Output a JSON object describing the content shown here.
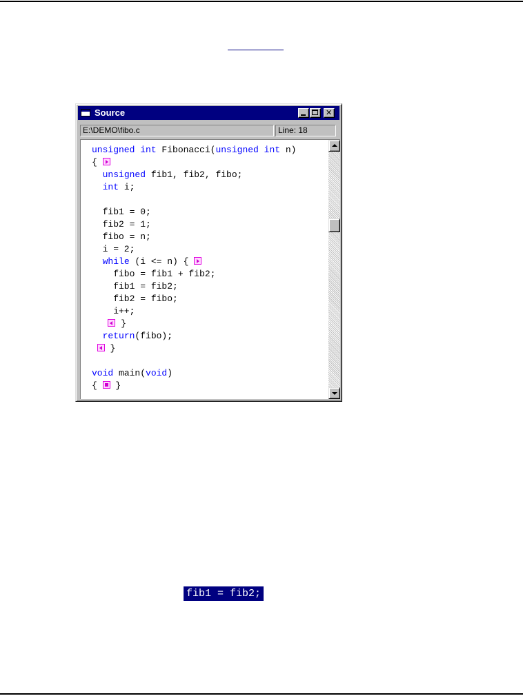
{
  "window": {
    "title": "Source",
    "file_path": "E:\\DEMO\\fibo.c",
    "line_status": "Line: 18"
  },
  "code": {
    "lines": [
      [
        {
          "t": "unsigned int",
          "c": "kw"
        },
        {
          "t": " Fibonacci("
        },
        {
          "t": "unsigned int",
          "c": "kw"
        },
        {
          "t": " n)"
        }
      ],
      [
        {
          "t": "{ "
        },
        {
          "fold": "right"
        }
      ],
      [
        {
          "t": "  "
        },
        {
          "t": "unsigned",
          "c": "kw"
        },
        {
          "t": " fib1, fib2, fibo;"
        }
      ],
      [
        {
          "t": "  "
        },
        {
          "t": "int",
          "c": "kw"
        },
        {
          "t": " i;"
        }
      ],
      [],
      [
        {
          "t": "  fib1 = 0;"
        }
      ],
      [
        {
          "t": "  fib2 = 1;"
        }
      ],
      [
        {
          "t": "  fibo = n;"
        }
      ],
      [
        {
          "t": "  i = 2;"
        }
      ],
      [
        {
          "t": "  "
        },
        {
          "t": "while",
          "c": "kw"
        },
        {
          "t": " (i <= n) { "
        },
        {
          "fold": "right"
        }
      ],
      [
        {
          "t": "    fibo = fib1 + fib2;"
        }
      ],
      [
        {
          "t": "    fib1 = fib2;"
        }
      ],
      [
        {
          "t": "    fib2 = fibo;"
        }
      ],
      [
        {
          "t": "    i++;"
        }
      ],
      [
        {
          "t": "   "
        },
        {
          "fold": "left"
        },
        {
          "t": " }"
        }
      ],
      [
        {
          "t": "  "
        },
        {
          "t": "return",
          "c": "kw"
        },
        {
          "t": "(fibo);"
        }
      ],
      [
        {
          "t": " "
        },
        {
          "fold": "left"
        },
        {
          "t": " }"
        }
      ],
      [],
      [
        {
          "t": "void",
          "c": "kw"
        },
        {
          "t": " main("
        },
        {
          "t": "void",
          "c": "kw"
        },
        {
          "t": ")"
        }
      ],
      [
        {
          "t": "{ "
        },
        {
          "fold": "square"
        },
        {
          "t": " }"
        }
      ]
    ]
  },
  "scrollbar": {
    "position": 0.3
  },
  "selection_snippet": "fib1 = fib2;",
  "colors": {
    "titlebar": "#000080",
    "keyword": "#0000ff",
    "fold_marker": "#e000e0",
    "selection_bg": "#000080"
  },
  "icons": {
    "fold_expand": "fold-expand-icon",
    "fold_collapse": "fold-collapse-icon",
    "fold_block": "fold-block-icon"
  }
}
